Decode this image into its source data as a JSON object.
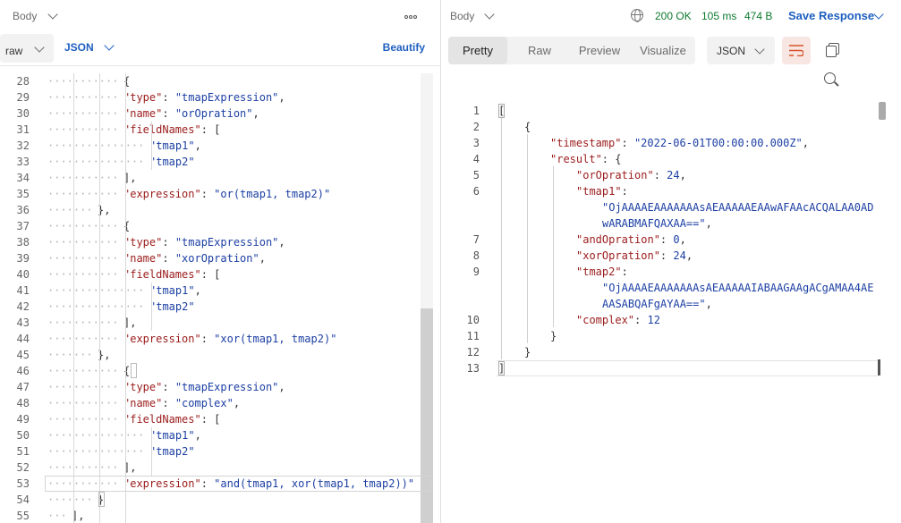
{
  "request": {
    "body_label": "Body",
    "mode_value": "raw",
    "format_value": "JSON",
    "beautify_label": "Beautify",
    "code_lines": [
      {
        "n": "28",
        "indent": 3,
        "parts": [
          [
            "p",
            "{"
          ]
        ]
      },
      {
        "n": "29",
        "indent": 3,
        "parts": [
          [
            "k",
            "\"type\""
          ],
          [
            "p",
            ": "
          ],
          [
            "s",
            "\"tmapExpression\""
          ],
          [
            "p",
            ","
          ]
        ]
      },
      {
        "n": "30",
        "indent": 3,
        "parts": [
          [
            "k",
            "\"name\""
          ],
          [
            "p",
            ": "
          ],
          [
            "s",
            "\"orOpration\""
          ],
          [
            "p",
            ","
          ]
        ]
      },
      {
        "n": "31",
        "indent": 3,
        "parts": [
          [
            "k",
            "\"fieldNames\""
          ],
          [
            "p",
            ": ["
          ]
        ]
      },
      {
        "n": "32",
        "indent": 4,
        "parts": [
          [
            "s",
            "\"tmap1\""
          ],
          [
            "p",
            ","
          ]
        ]
      },
      {
        "n": "33",
        "indent": 4,
        "parts": [
          [
            "s",
            "\"tmap2\""
          ]
        ]
      },
      {
        "n": "34",
        "indent": 3,
        "parts": [
          [
            "p",
            "],"
          ]
        ]
      },
      {
        "n": "35",
        "indent": 3,
        "parts": [
          [
            "k",
            "\"expression\""
          ],
          [
            "p",
            ": "
          ],
          [
            "s",
            "\"or(tmap1, tmap2)\""
          ]
        ]
      },
      {
        "n": "36",
        "indent": 2,
        "parts": [
          [
            "p",
            "},"
          ]
        ]
      },
      {
        "n": "37",
        "indent": 3,
        "parts": [
          [
            "p",
            "{"
          ]
        ]
      },
      {
        "n": "38",
        "indent": 3,
        "parts": [
          [
            "k",
            "\"type\""
          ],
          [
            "p",
            ": "
          ],
          [
            "s",
            "\"tmapExpression\""
          ],
          [
            "p",
            ","
          ]
        ]
      },
      {
        "n": "39",
        "indent": 3,
        "parts": [
          [
            "k",
            "\"name\""
          ],
          [
            "p",
            ": "
          ],
          [
            "s",
            "\"xorOpration\""
          ],
          [
            "p",
            ","
          ]
        ]
      },
      {
        "n": "40",
        "indent": 3,
        "parts": [
          [
            "k",
            "\"fieldNames\""
          ],
          [
            "p",
            ": ["
          ]
        ]
      },
      {
        "n": "41",
        "indent": 4,
        "parts": [
          [
            "s",
            "\"tmap1\""
          ],
          [
            "p",
            ","
          ]
        ]
      },
      {
        "n": "42",
        "indent": 4,
        "parts": [
          [
            "s",
            "\"tmap2\""
          ]
        ]
      },
      {
        "n": "43",
        "indent": 3,
        "parts": [
          [
            "p",
            "],"
          ]
        ]
      },
      {
        "n": "44",
        "indent": 3,
        "parts": [
          [
            "k",
            "\"expression\""
          ],
          [
            "p",
            ": "
          ],
          [
            "s",
            "\"xor(tmap1, tmap2)\""
          ]
        ]
      },
      {
        "n": "45",
        "indent": 2,
        "parts": [
          [
            "p",
            "},"
          ]
        ]
      },
      {
        "n": "46",
        "indent": 3,
        "parts": [
          [
            "p",
            "{"
          ]
        ]
      },
      {
        "n": "47",
        "indent": 3,
        "parts": [
          [
            "k",
            "\"type\""
          ],
          [
            "p",
            ": "
          ],
          [
            "s",
            "\"tmapExpression\""
          ],
          [
            "p",
            ","
          ]
        ]
      },
      {
        "n": "48",
        "indent": 3,
        "parts": [
          [
            "k",
            "\"name\""
          ],
          [
            "p",
            ": "
          ],
          [
            "s",
            "\"complex\""
          ],
          [
            "p",
            ","
          ]
        ]
      },
      {
        "n": "49",
        "indent": 3,
        "parts": [
          [
            "k",
            "\"fieldNames\""
          ],
          [
            "p",
            ": ["
          ]
        ]
      },
      {
        "n": "50",
        "indent": 4,
        "parts": [
          [
            "s",
            "\"tmap1\""
          ],
          [
            "p",
            ","
          ]
        ]
      },
      {
        "n": "51",
        "indent": 4,
        "parts": [
          [
            "s",
            "\"tmap2\""
          ]
        ]
      },
      {
        "n": "52",
        "indent": 3,
        "parts": [
          [
            "p",
            "],"
          ]
        ]
      },
      {
        "n": "53",
        "indent": 3,
        "parts": [
          [
            "k",
            "\"expression\""
          ],
          [
            "p",
            ": "
          ],
          [
            "s",
            "\"and(tmap1, xor(tmap1, tmap2))\""
          ]
        ]
      },
      {
        "n": "54",
        "indent": 2,
        "parts": [
          [
            "p",
            "}"
          ]
        ]
      },
      {
        "n": "55",
        "indent": 1,
        "parts": [
          [
            "p",
            "],"
          ]
        ]
      }
    ]
  },
  "response": {
    "body_label": "Body",
    "status_code": "200 OK",
    "time": "105 ms",
    "size": "474 B",
    "save_label": "Save Response",
    "tabs": [
      "Pretty",
      "Raw",
      "Preview",
      "Visualize"
    ],
    "active_tab": "Pretty",
    "format_value": "JSON",
    "lines": [
      {
        "n": "1",
        "col": 0,
        "parts": [
          [
            "p",
            "["
          ]
        ]
      },
      {
        "n": "2",
        "col": 1,
        "parts": [
          [
            "p",
            "{"
          ]
        ]
      },
      {
        "n": "3",
        "col": 2,
        "parts": [
          [
            "k",
            "\"timestamp\""
          ],
          [
            "p",
            ": "
          ],
          [
            "s",
            "\"2022-06-01T00:00:00.000Z\""
          ],
          [
            "p",
            ","
          ]
        ]
      },
      {
        "n": "4",
        "col": 2,
        "parts": [
          [
            "k",
            "\"result\""
          ],
          [
            "p",
            ": {"
          ]
        ]
      },
      {
        "n": "5",
        "col": 3,
        "parts": [
          [
            "k",
            "\"orOpration\""
          ],
          [
            "p",
            ": "
          ],
          [
            "s",
            "24"
          ],
          [
            "p",
            ","
          ]
        ]
      },
      {
        "n": "6",
        "col": 3,
        "parts": [
          [
            "k",
            "\"tmap1\""
          ],
          [
            "p",
            ":"
          ]
        ]
      },
      {
        "n": "",
        "col": 4,
        "parts": [
          [
            "s",
            "\"OjAAAAEAAAAAAAsAEAAAAAEAAwAFAAcACQALAA0AD"
          ]
        ]
      },
      {
        "n": "",
        "col": 4,
        "parts": [
          [
            "s",
            "wARABMAFQAXAA==\""
          ],
          [
            "p",
            ","
          ]
        ]
      },
      {
        "n": "7",
        "col": 3,
        "parts": [
          [
            "k",
            "\"andOpration\""
          ],
          [
            "p",
            ": "
          ],
          [
            "s",
            "0"
          ],
          [
            "p",
            ","
          ]
        ]
      },
      {
        "n": "8",
        "col": 3,
        "parts": [
          [
            "k",
            "\"xorOpration\""
          ],
          [
            "p",
            ": "
          ],
          [
            "s",
            "24"
          ],
          [
            "p",
            ","
          ]
        ]
      },
      {
        "n": "9",
        "col": 3,
        "parts": [
          [
            "k",
            "\"tmap2\""
          ],
          [
            "p",
            ":"
          ]
        ]
      },
      {
        "n": "",
        "col": 4,
        "parts": [
          [
            "s",
            "\"OjAAAAEAAAAAAAsAEAAAAAIABAAGAAgACgAMAA4AE"
          ]
        ]
      },
      {
        "n": "",
        "col": 4,
        "parts": [
          [
            "s",
            "AASABQAFgAYAA==\""
          ],
          [
            "p",
            ","
          ]
        ]
      },
      {
        "n": "10",
        "col": 3,
        "parts": [
          [
            "k",
            "\"complex\""
          ],
          [
            "p",
            ": "
          ],
          [
            "s",
            "12"
          ]
        ]
      },
      {
        "n": "11",
        "col": 2,
        "parts": [
          [
            "p",
            "}"
          ]
        ]
      },
      {
        "n": "12",
        "col": 1,
        "parts": [
          [
            "p",
            "}"
          ]
        ]
      },
      {
        "n": "13",
        "col": 0,
        "parts": [
          [
            "p",
            "]"
          ]
        ]
      }
    ]
  }
}
